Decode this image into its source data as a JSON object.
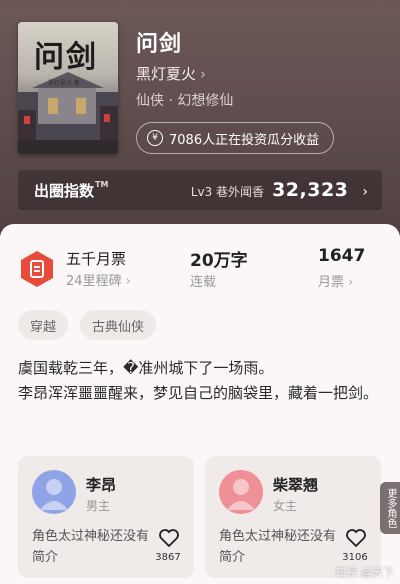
{
  "book": {
    "cover_title": "问剑",
    "cover_subtitle": "黑灯夏火 著",
    "title": "问剑",
    "author": "黑灯夏火",
    "genre": "仙侠 · 幻想修仙",
    "invest_text": "7086人正在投资瓜分收益"
  },
  "rank_bar": {
    "label": "出圈指数",
    "trademark": "TM",
    "level": "Lv3 巷外闻香",
    "score": "32,323"
  },
  "stats": {
    "monthly_ticket_title": "五千月票",
    "monthly_ticket_sub": "24里程碑",
    "word_count": "20万字",
    "word_status": "连载",
    "monthly_votes": "1647",
    "monthly_votes_label": "月票"
  },
  "tags": [
    "穿越",
    "古典仙侠"
  ],
  "description": [
    "虞国载乾三年，�准州城下了一场雨。",
    "李昂浑浑噩噩醒来，梦见自己的脑袋里，藏着一把剑。"
  ],
  "characters": [
    {
      "name": "李昂",
      "role": "男主",
      "intro": "角色太过神秘还没有简介",
      "likes": "3867",
      "avatar_color": "#8fa3e6"
    },
    {
      "name": "柴翠翘",
      "role": "女主",
      "intro": "角色太过神秘还没有简介",
      "likes": "3106",
      "avatar_color": "#ef8f98"
    }
  ],
  "side_tab": "更多角色",
  "watermark": "知乎 @天下"
}
